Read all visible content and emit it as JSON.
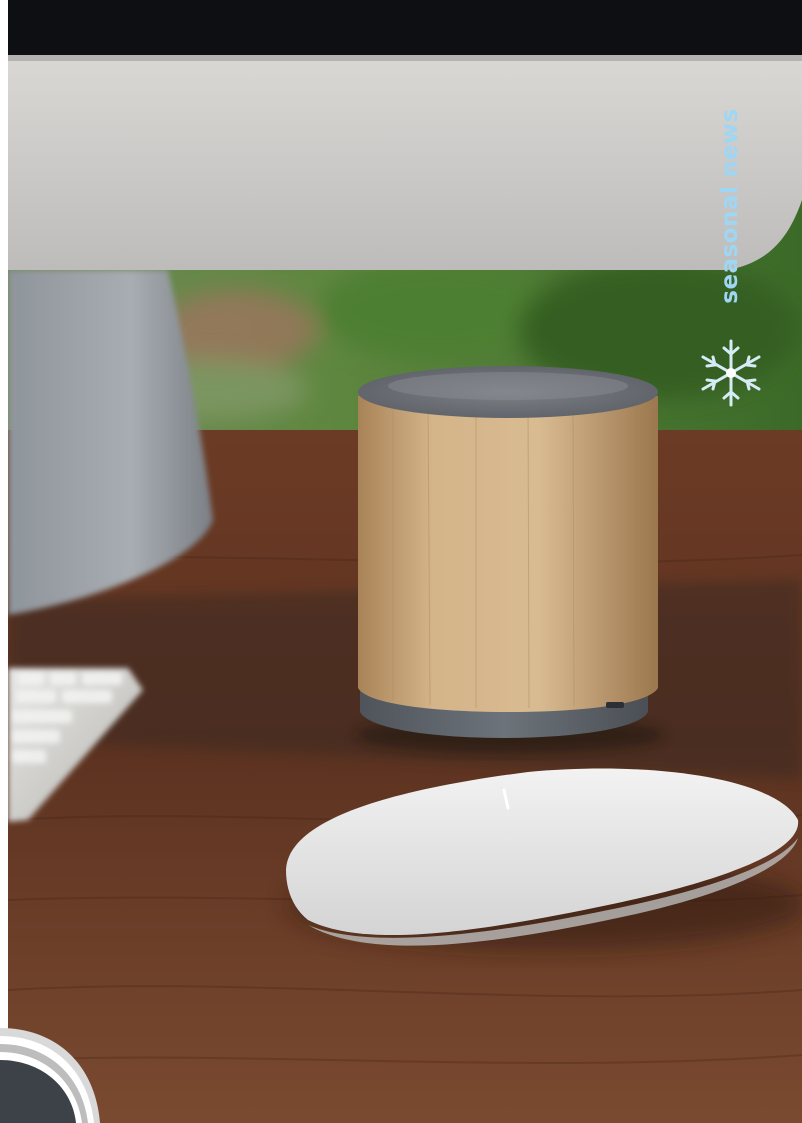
{
  "promo": {
    "side_label": "seasonal news"
  },
  "icons": {
    "decoration": "snowflake-icon",
    "corner": "corner-badge-icon"
  },
  "colors": {
    "label": "#9ed6f3",
    "snowflake": "#cfe7f4",
    "desk": "#6e3d25",
    "bamboo": "#cfae82",
    "speaker_base": "#5f656d"
  }
}
